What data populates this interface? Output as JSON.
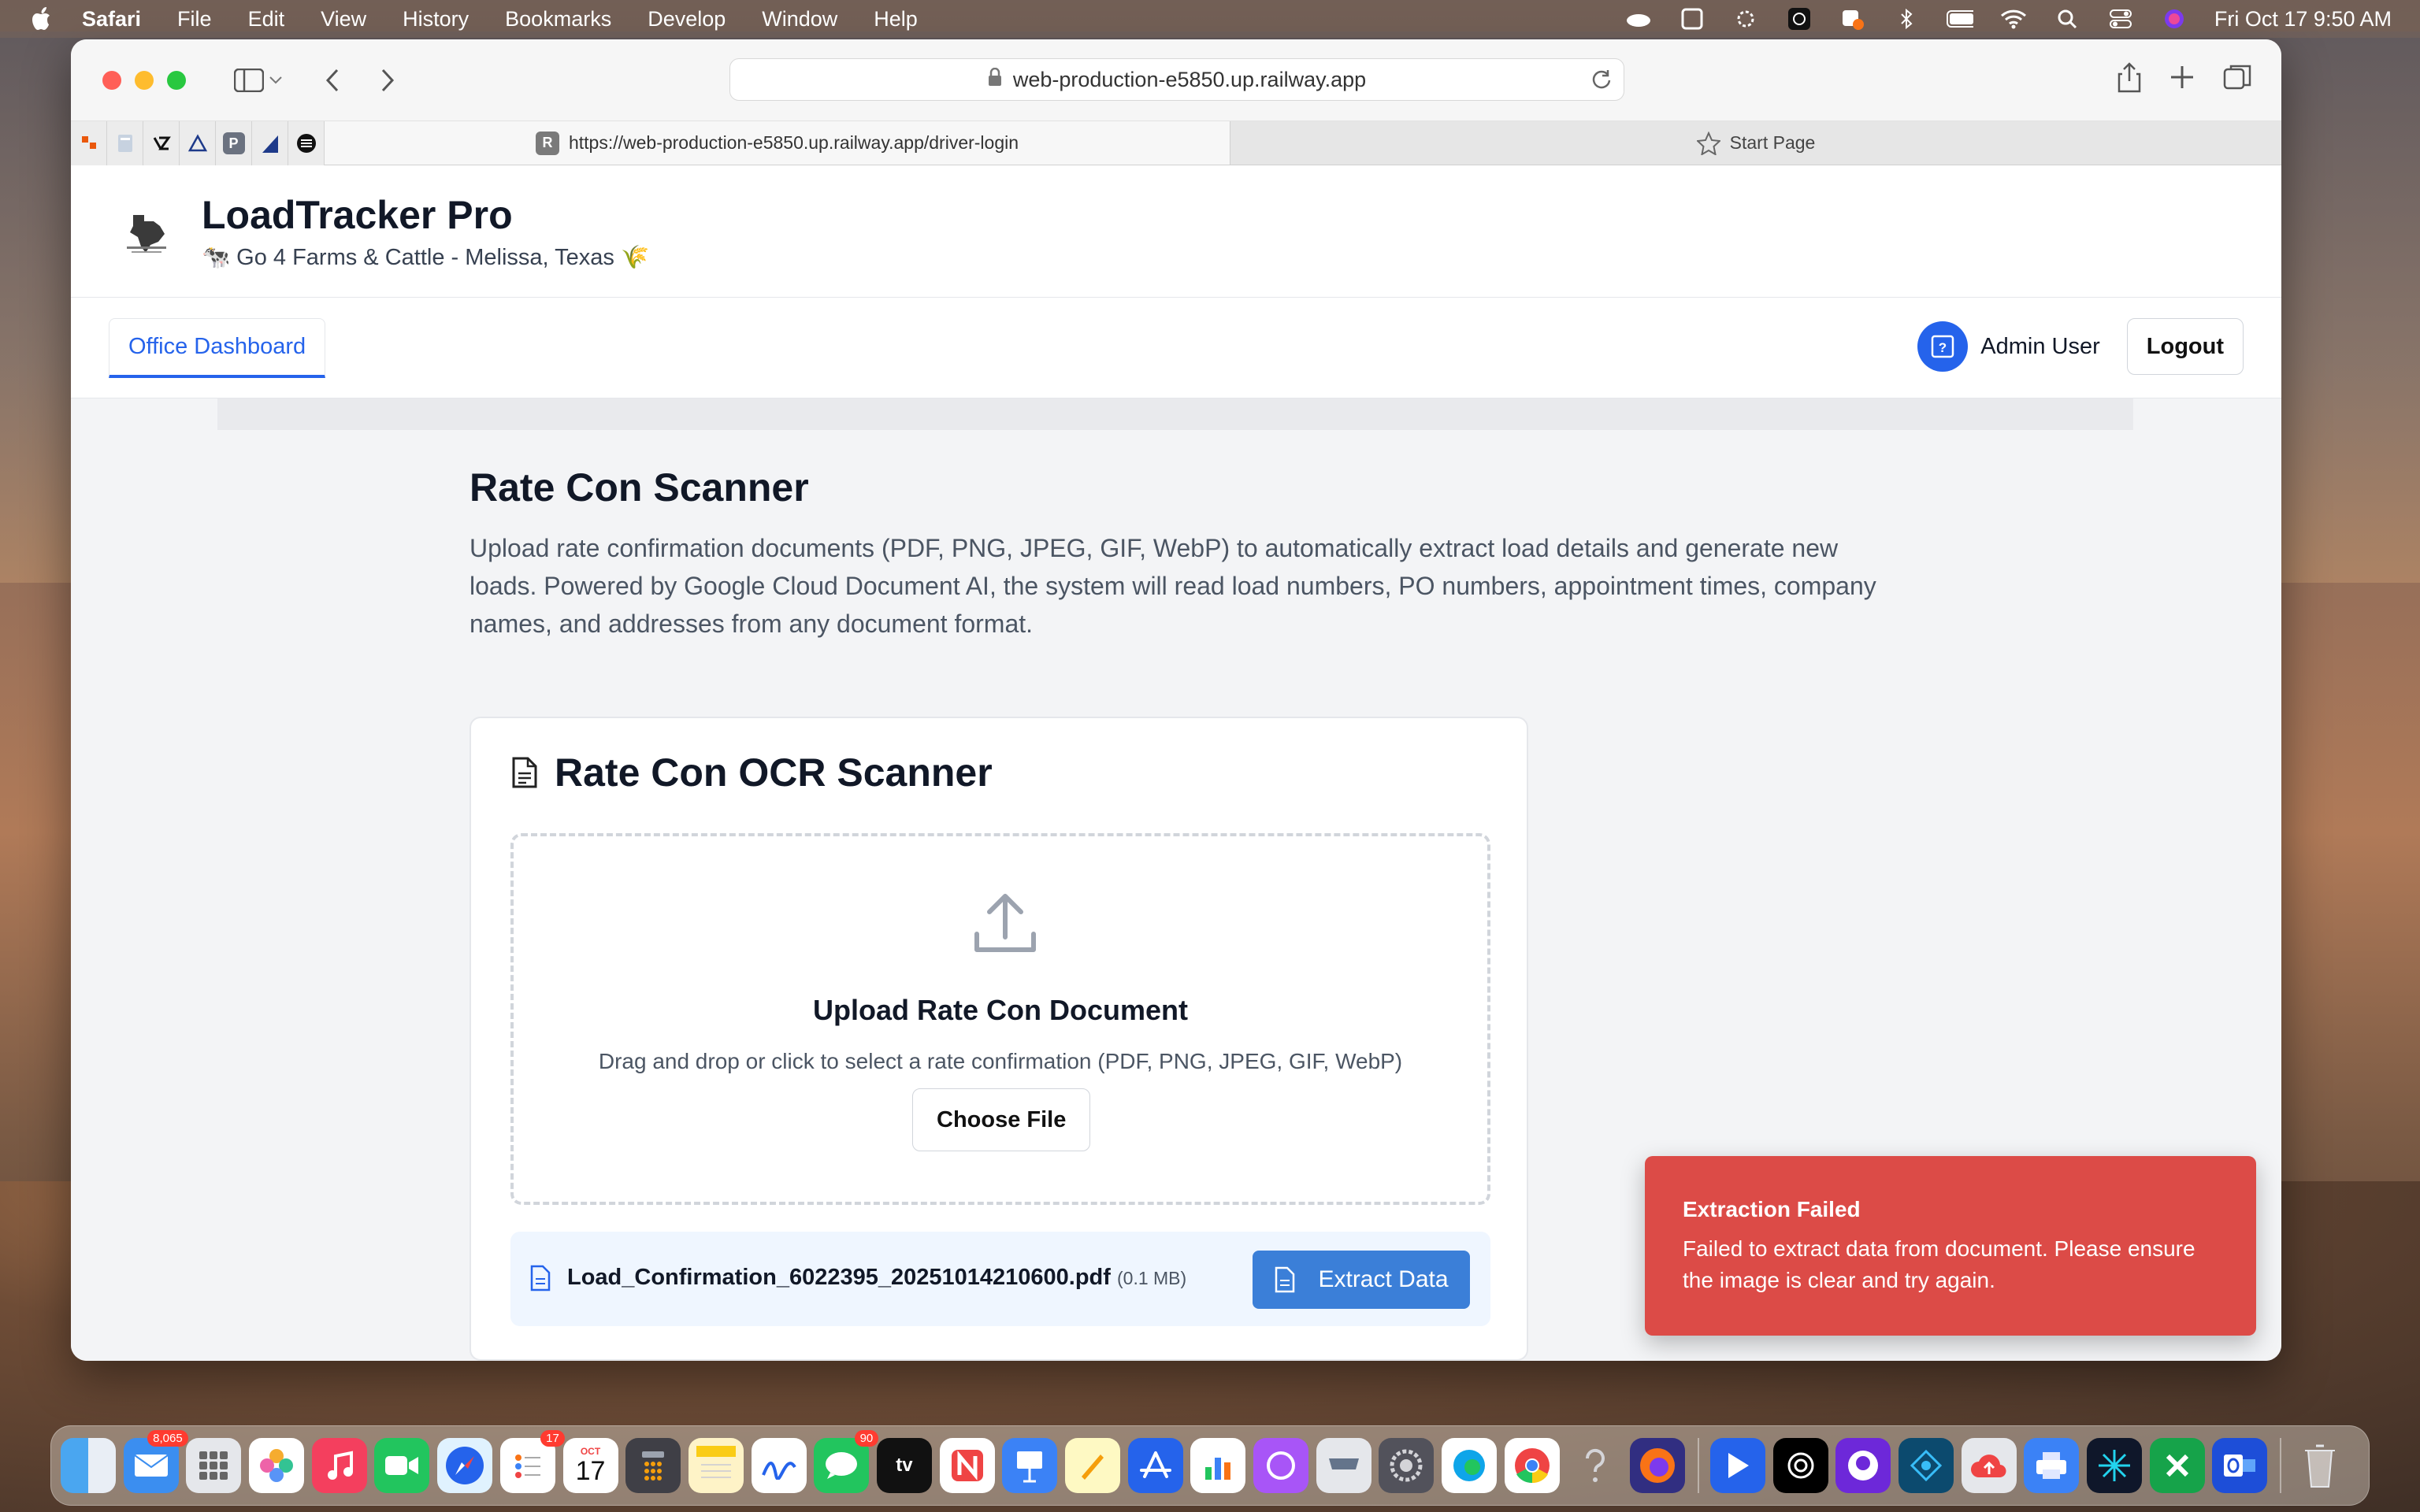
{
  "menubar": {
    "app": "Safari",
    "items": [
      "File",
      "Edit",
      "View",
      "History",
      "Bookmarks",
      "Develop",
      "Window",
      "Help"
    ],
    "datetime": "Fri Oct 17  9:50 AM"
  },
  "browser": {
    "url": "web-production-e5850.up.railway.app",
    "tabs": [
      {
        "label": "https://web-production-e5850.up.railway.app/driver-login",
        "favicon": "R"
      },
      {
        "label": "Start Page"
      }
    ],
    "pinned_tabs": [
      "P"
    ]
  },
  "app": {
    "title": "LoadTracker Pro",
    "subtitle": "🐄 Go 4 Farms & Cattle - Melissa, Texas 🌾"
  },
  "nav": {
    "active_tab": "Office Dashboard",
    "user_name": "Admin User",
    "logout_label": "Logout"
  },
  "main": {
    "heading": "Rate Con Scanner",
    "description": "Upload rate confirmation documents (PDF, PNG, JPEG, GIF, WebP) to automatically extract load details and generate new loads. Powered by Google Cloud Document AI, the system will read load numbers, PO numbers, appointment times, company names, and addresses from any document format."
  },
  "scanner": {
    "title": "Rate Con OCR Scanner",
    "upload_title": "Upload Rate Con Document",
    "upload_hint": "Drag and drop or click to select a rate confirmation (PDF, PNG, JPEG, GIF, WebP)",
    "choose_label": "Choose File",
    "file": {
      "name": "Load_Confirmation_6022395_20251014210600.pdf",
      "size": "(0.1 MB)"
    },
    "extract_label": "Extract Data"
  },
  "toast": {
    "title": "Extraction Failed",
    "message": "Failed to extract data from document. Please ensure the image is clear and try again."
  },
  "dock": {
    "badges": {
      "mail": "8,065",
      "reminders": "17",
      "messages": "90"
    },
    "calendar_month": "OCT",
    "calendar_day": "17",
    "tv_label": "tv"
  },
  "colors": {
    "accent": "#2563eb",
    "button": "#3b7fd8",
    "error": "#dc4b47"
  }
}
